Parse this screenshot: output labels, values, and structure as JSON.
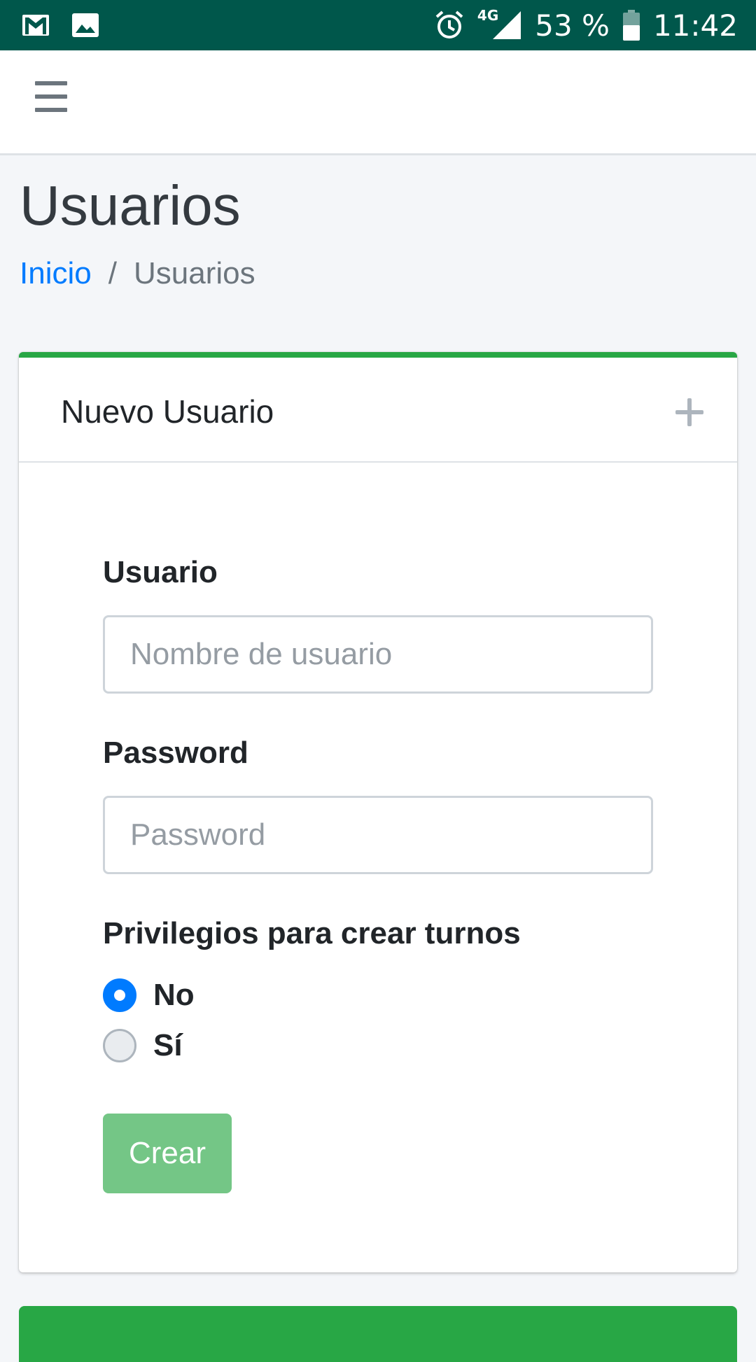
{
  "status_bar": {
    "network": "4G",
    "battery": "53 %",
    "time": "11:42",
    "icons": [
      "gmail-icon",
      "image-icon",
      "alarm-icon",
      "signal-icon",
      "battery-icon"
    ]
  },
  "page": {
    "title": "Usuarios",
    "breadcrumb": {
      "home": "Inicio",
      "separator": "/",
      "current": "Usuarios"
    }
  },
  "card": {
    "title": "Nuevo Usuario",
    "accent_color": "#28a745"
  },
  "form": {
    "username_label": "Usuario",
    "username_placeholder": "Nombre de usuario",
    "password_label": "Password",
    "password_placeholder": "Password",
    "privileges_label": "Privilegios para crear turnos",
    "options": [
      {
        "label": "No",
        "selected": true
      },
      {
        "label": "Sí",
        "selected": false
      }
    ],
    "submit_label": "Crear"
  },
  "colors": {
    "status_bar": "#00574b",
    "link": "#007bff",
    "success": "#28a745",
    "button_disabled": "#74c686"
  }
}
